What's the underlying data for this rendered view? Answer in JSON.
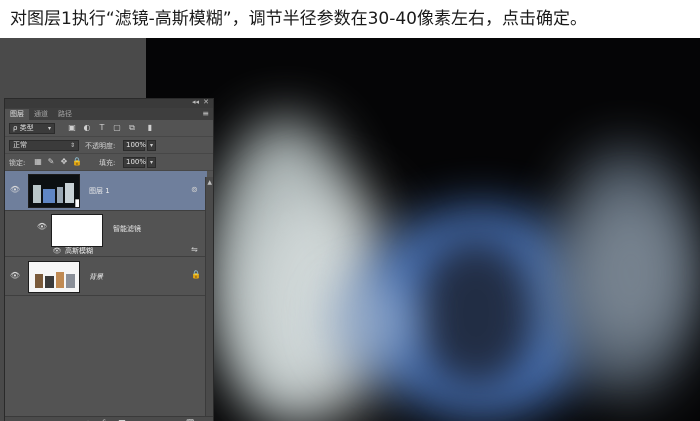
{
  "caption": "对图层1执行“滤镜-高斯模糊”，调节半径参数在30-40像素左右，点击确定。",
  "panel": {
    "tabs": [
      "图层",
      "通道",
      "路径"
    ],
    "filter_kind": "ρ 类型",
    "blend_mode": "正常",
    "opacity_label": "不透明度:",
    "opacity_value": "100%",
    "lock_label": "锁定:",
    "fill_label": "填充:",
    "fill_value": "100%",
    "layers": {
      "layer1_name": "图层 1",
      "smart_filters_name": "智能滤镜",
      "gaussian_blur_name": "高斯模糊",
      "background_name": "背景"
    }
  },
  "colors": {
    "panel_bg": "#535353",
    "selected_layer": "#6f7f9c",
    "canvas_blue": "#4c79c2"
  },
  "icons": {
    "eye": "eye-icon",
    "lock": "lock-icon",
    "link": "link-icon",
    "fx": "fx-icon",
    "mask": "mask-icon",
    "adjustment": "adjustment-layer-icon",
    "group": "folder-icon",
    "new_layer": "new-layer-icon",
    "delete": "trash-icon"
  }
}
